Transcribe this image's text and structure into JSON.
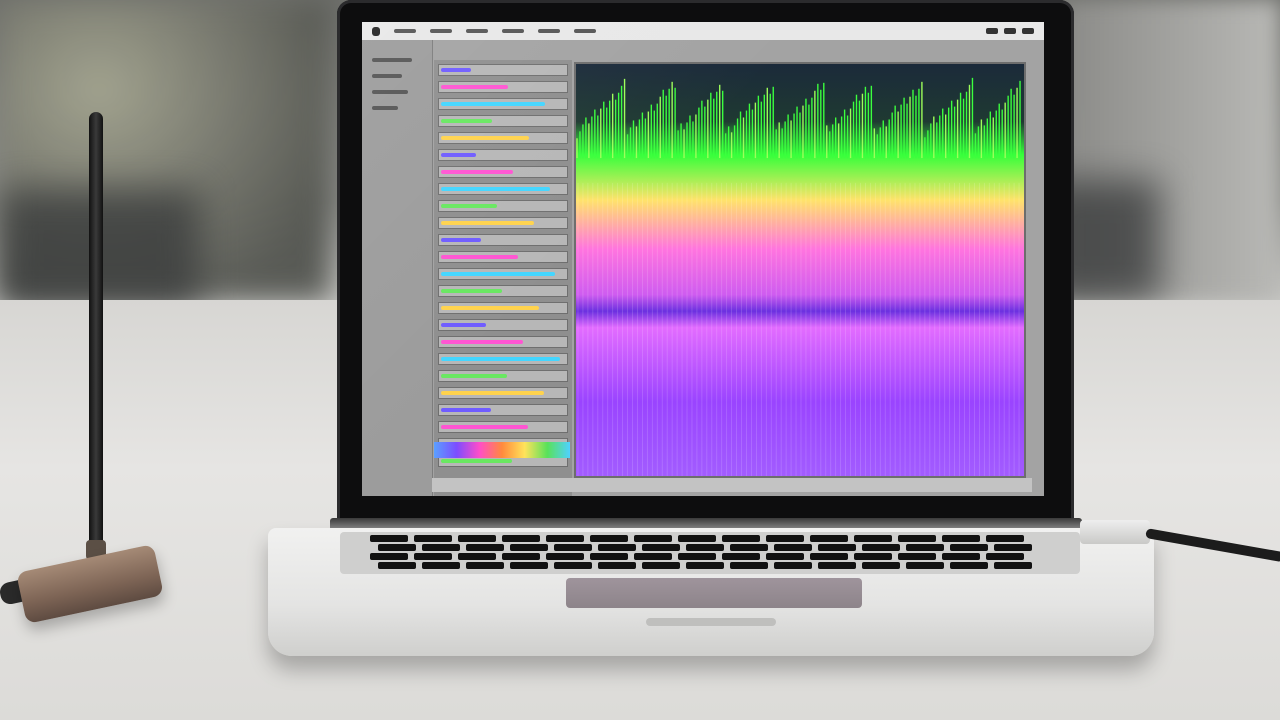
{
  "scene": {
    "main_subject": "laptop",
    "accessories": [
      "antenna-dongle",
      "usb-cable"
    ]
  },
  "screen_app": {
    "visible_text": [],
    "spectrogram_colors": [
      "#1b2a3a",
      "#35ff3a",
      "#ffe36a",
      "#ff5cf2",
      "#8a37ff"
    ]
  }
}
